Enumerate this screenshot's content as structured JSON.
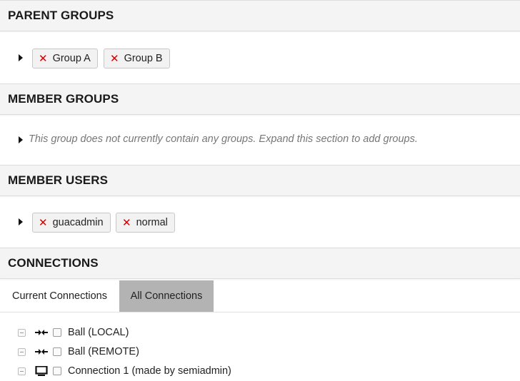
{
  "sections": {
    "parent_groups": {
      "title": "PARENT GROUPS",
      "chips": [
        "Group A",
        "Group B"
      ]
    },
    "member_groups": {
      "title": "MEMBER GROUPS",
      "empty_note": "This group does not currently contain any groups. Expand this section to add groups."
    },
    "member_users": {
      "title": "MEMBER USERS",
      "chips": [
        "guacadmin",
        "normal"
      ]
    },
    "connections": {
      "title": "CONNECTIONS",
      "tabs": [
        "Current Connections",
        "All Connections"
      ],
      "active_tab": "All Connections",
      "items": [
        {
          "label": "Ball (LOCAL)",
          "icon": "plug-icon"
        },
        {
          "label": "Ball (REMOTE)",
          "icon": "plug-icon"
        },
        {
          "label": "Connection 1 (made by semiadmin)",
          "icon": "monitor-icon"
        }
      ]
    }
  },
  "colors": {
    "remove": "#d10000",
    "active_tab": "#b3b3b3",
    "header_bg": "#f4f4f4"
  }
}
